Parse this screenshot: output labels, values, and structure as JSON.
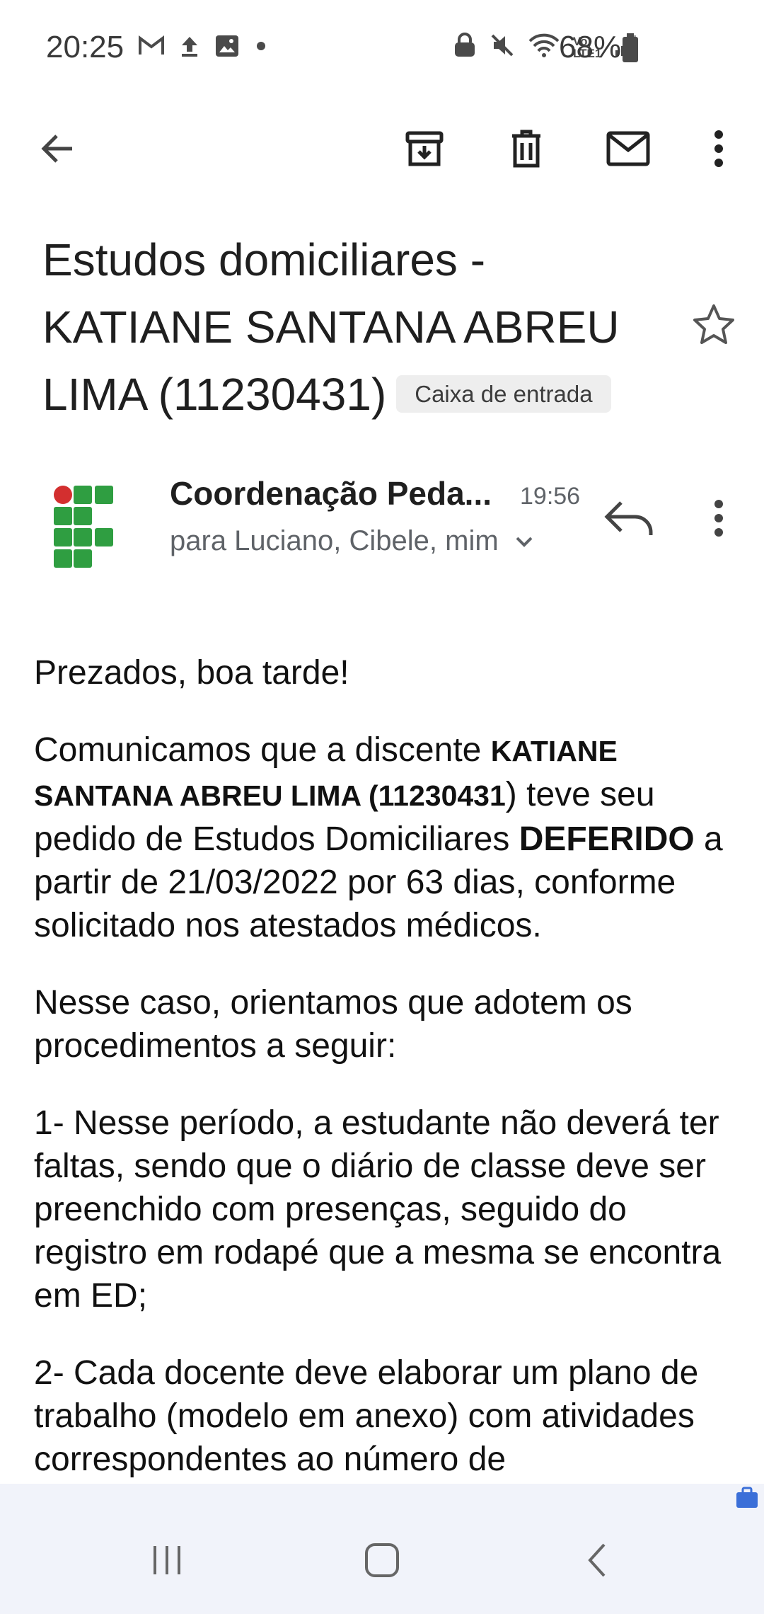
{
  "status_bar": {
    "time": "20:25",
    "battery": "68%",
    "icons_left": [
      "gmail-icon",
      "upload-icon",
      "image-icon",
      "dot-icon"
    ],
    "icons_right": [
      "lock-icon",
      "mute-icon",
      "wifi-icon",
      "volte-icon",
      "signal-icon",
      "battery-icon"
    ],
    "volte_text": "Vo) LTE1"
  },
  "toolbar": {
    "back": "back-arrow-icon",
    "archive": "archive-icon",
    "delete": "trash-icon",
    "mark_unread": "mail-icon",
    "more": "more-vert-icon"
  },
  "email": {
    "subject": "Estudos domiciliares - KATIANE SANTANA ABREU LIMA (11230431)",
    "label": "Caixa de entrada",
    "sender": "Coordenação Peda...",
    "time": "19:56",
    "recipients": "para Luciano, Cibele, mim",
    "colors": {
      "logo_green": "#2f9e41",
      "logo_red": "#d32f2f"
    }
  },
  "body": {
    "greeting": "Prezados, boa tarde!",
    "p1_a": "Comunicamos que a discente ",
    "p1_name": "KATIANE SANTANA ABREU LIMA (11230431",
    "p1_b": ")  teve seu pedido de Estudos Domiciliares ",
    "p1_status": "DEFERIDO",
    "p1_c": " a partir de 21/03/2022 por 63 dias, conforme solicitado nos atestados médicos.",
    "p2": "Nesse caso, orientamos que adotem os procedimentos a seguir:",
    "p3": "1- Nesse período, a estudante não deverá ter faltas, sendo que o diário de classe deve ser preenchido com presenças, seguido do registro em rodapé que a mesma se encontra em ED;",
    "p4": "2- Cada docente deve elaborar um plano de trabalho (modelo em anexo) com atividades correspondentes ao número de"
  },
  "nav_bar": {
    "recents": "recents-icon",
    "home": "home-icon",
    "back": "nav-back-icon"
  }
}
